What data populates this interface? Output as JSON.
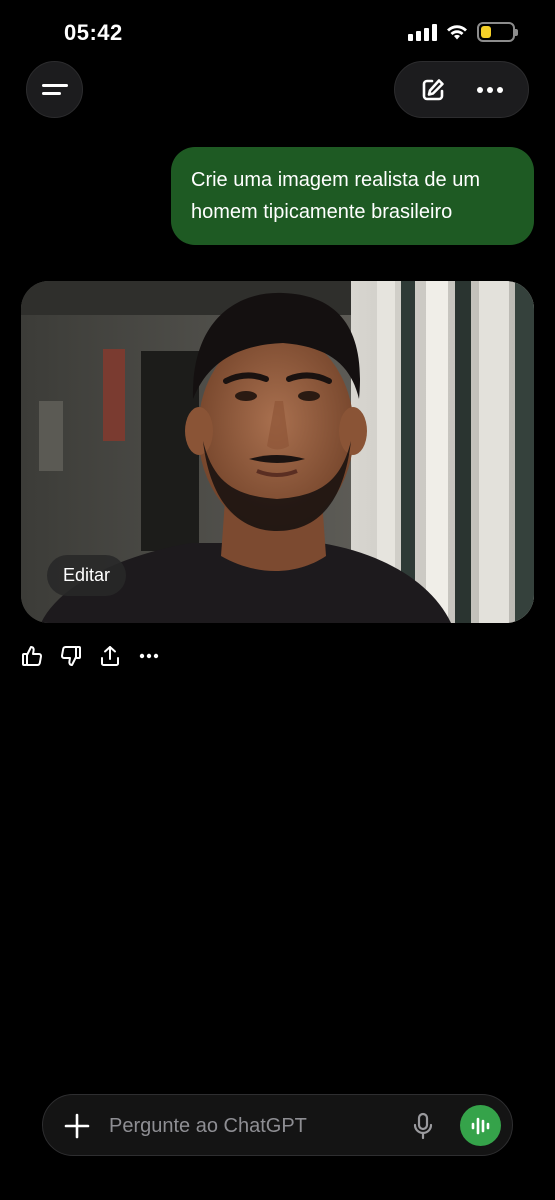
{
  "status": {
    "time": "05:42",
    "battery_level": 0.25,
    "battery_color": "#f5d028"
  },
  "header": {
    "menu_icon": "hamburger-icon",
    "new_chat_icon": "edit-icon",
    "more_icon": "more-icon"
  },
  "conversation": {
    "user_message": "Crie uma imagem realista de um homem tipicamente brasileiro",
    "user_bubble_color": "#1e5a23",
    "generated_image": {
      "edit_label": "Editar"
    },
    "actions": [
      "thumbs-up-icon",
      "thumbs-down-icon",
      "share-icon",
      "more-icon"
    ]
  },
  "composer": {
    "placeholder": "Pergunte ao ChatGPT",
    "accent_color": "#35a34a"
  }
}
